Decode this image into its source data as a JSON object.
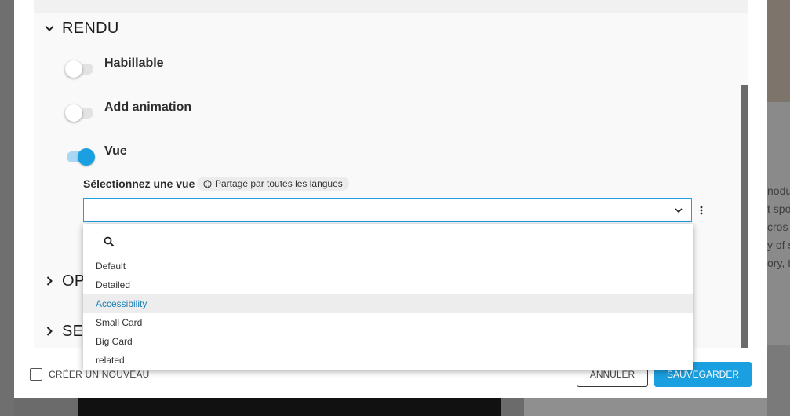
{
  "background": {
    "right_text_lines": [
      "nodu",
      "t spo",
      "cros",
      "y of s",
      "ory, t"
    ]
  },
  "sections": {
    "rendu": {
      "title": "RENDU"
    },
    "collapsed": [
      {
        "title": "OP"
      },
      {
        "title": "SE"
      }
    ]
  },
  "toggles": [
    {
      "label": "Habillable",
      "on": false
    },
    {
      "label": "Add animation",
      "on": false
    },
    {
      "label": "Vue",
      "on": true
    }
  ],
  "view_select": {
    "label": "Sélectionnez une vue",
    "badge": "Partagé par toutes les langues",
    "value": ""
  },
  "dropdown": {
    "search_placeholder": "",
    "options": [
      {
        "label": "Default",
        "active": false
      },
      {
        "label": "Detailed",
        "active": false
      },
      {
        "label": "Accessibility",
        "active": true
      },
      {
        "label": "Small Card",
        "active": false
      },
      {
        "label": "Big Card",
        "active": false
      },
      {
        "label": "related",
        "active": false
      }
    ]
  },
  "footer": {
    "checkbox_label": "CRÉER UN NOUVEAU",
    "cancel_label": "ANNULER",
    "save_label": "SAUVEGARDER"
  },
  "colors": {
    "accent": "#1a9fe0",
    "active_option_text": "#1a7fb5"
  }
}
